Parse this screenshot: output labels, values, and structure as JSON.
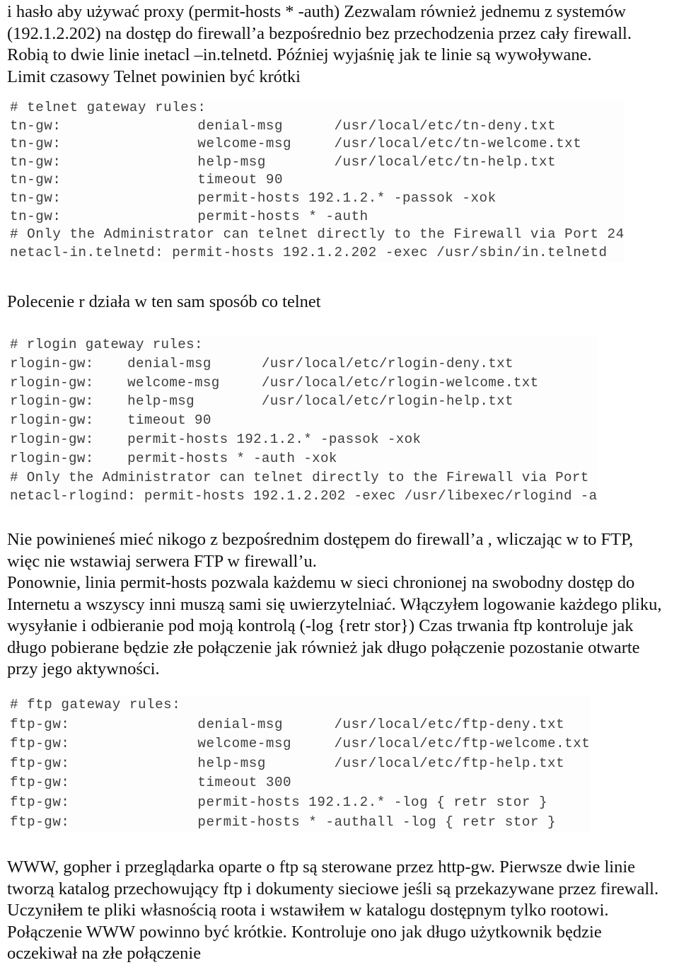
{
  "document": {
    "paragraphs": {
      "intro": {
        "lines": [
          "i hasło aby używać proxy (permit-hosts * -auth) Zezwalam również jednemu z systemów",
          "(192.1.2.202) na dostęp do firewall’a bezpośrednio bez przechodzenia przez cały firewall.",
          "Robią to dwie linie inetacl –in.telnetd. Później wyjaśnię jak te linie są wywoływane.",
          "Limit czasowy Telnet powinien być krótki"
        ]
      },
      "rlogin_caption": {
        "lines": [
          "Polecenie r  działa w ten sam sposób co telnet"
        ]
      },
      "ftp_note": {
        "lines": [
          "Nie powinieneś mieć nikogo z bezpośrednim dostępem do firewall’a , wliczając w to FTP,",
          "więc nie wstawiaj serwera FTP w firewall’u.",
          "Ponownie, linia permit-hosts pozwala każdemu w sieci chronionej na swobodny dostęp do",
          "Internetu a wszyscy inni muszą sami się uwierzytelniać. Włączyłem logowanie każdego pliku,",
          "wysyłanie i odbieranie pod moją kontrolą (-log {retr stor}) Czas trwania ftp kontroluje jak",
          "długo pobierane będzie złe połączenie jak również jak długo połączenie pozostanie otwarte",
          "przy jego aktywności."
        ]
      },
      "www_note": {
        "lines": [
          "WWW, gopher i przeglądarka oparte o ftp są sterowane przez http-gw. Pierwsze dwie linie",
          "tworzą katalog przechowujący ftp i dokumenty sieciowe jeśli są przekazywane przez firewall.",
          "Uczyniłem te pliki własnością roota i wstawiłem w katalogu dostępnym tylko rootowi.",
          "Połączenie WWW powinno być krótkie. Kontroluje ono jak długo użytkownik będzie",
          "oczekiwał na złe połączenie"
        ]
      }
    },
    "code_blocks": {
      "telnet": {
        "title": "# telnet gateway rules:",
        "lines": [
          "# telnet gateway rules:",
          "tn-gw:                denial-msg      /usr/local/etc/tn-deny.txt",
          "tn-gw:                welcome-msg     /usr/local/etc/tn-welcome.txt",
          "tn-gw:                help-msg        /usr/local/etc/tn-help.txt",
          "tn-gw:                timeout 90",
          "tn-gw:                permit-hosts 192.1.2.* -passok -xok",
          "tn-gw:                permit-hosts * -auth",
          "# Only the Administrator can telnet directly to the Firewall via Port 24",
          "netacl-in.telnetd: permit-hosts 192.1.2.202 -exec /usr/sbin/in.telnetd"
        ]
      },
      "rlogin": {
        "title": "# rlogin gateway rules:",
        "lines": [
          "# rlogin gateway rules:",
          "rlogin-gw:    denial-msg      /usr/local/etc/rlogin-deny.txt",
          "rlogin-gw:    welcome-msg     /usr/local/etc/rlogin-welcome.txt",
          "rlogin-gw:    help-msg        /usr/local/etc/rlogin-help.txt",
          "rlogin-gw:    timeout 90",
          "rlogin-gw:    permit-hosts 192.1.2.* -passok -xok",
          "rlogin-gw:    permit-hosts * -auth -xok",
          "# Only the Administrator can telnet directly to the Firewall via Port",
          "netacl-rlogind: permit-hosts 192.1.2.202 -exec /usr/libexec/rlogind -a"
        ]
      },
      "ftp": {
        "title": "# ftp gateway rules:",
        "lines": [
          "# ftp gateway rules:",
          "ftp-gw:               denial-msg      /usr/local/etc/ftp-deny.txt",
          "ftp-gw:               welcome-msg     /usr/local/etc/ftp-welcome.txt",
          "ftp-gw:               help-msg        /usr/local/etc/ftp-help.txt",
          "ftp-gw:               timeout 300",
          "ftp-gw:               permit-hosts 192.1.2.* -log { retr stor }",
          "ftp-gw:               permit-hosts * -authall -log { retr stor }"
        ]
      }
    },
    "colors": {
      "page_background": "#ffffff",
      "body_text": "#111111",
      "code_text": "#3d3d3d",
      "code_background": "#fdfdfd"
    }
  }
}
